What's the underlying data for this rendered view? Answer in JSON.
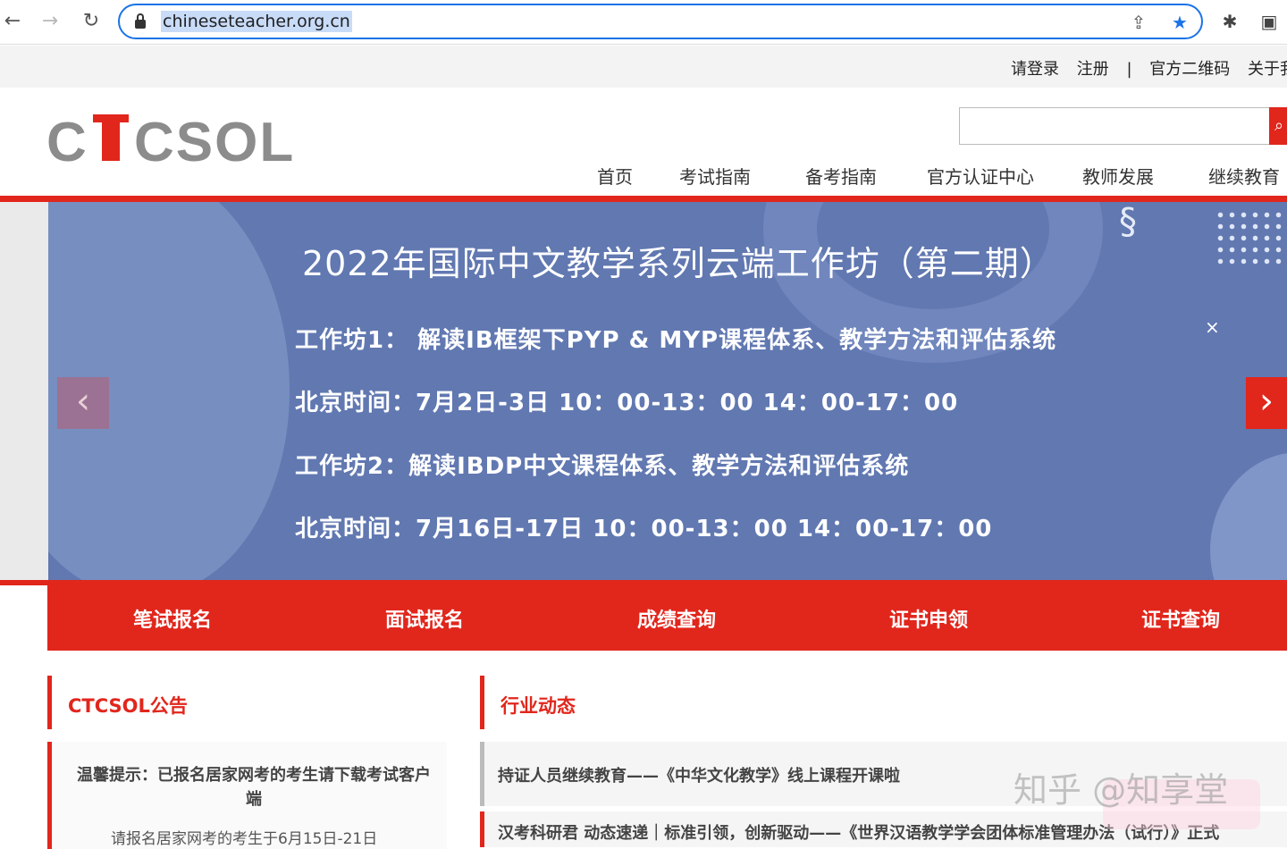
{
  "browser": {
    "url": "chineseteacher.org.cn",
    "back_icon": "←",
    "forward_icon": "→",
    "reload_icon": "↻",
    "share_icon": "⇪",
    "star_icon": "★",
    "extensions_icon": "✱",
    "window_icon": "▣"
  },
  "topbar": {
    "login": "请登录",
    "register": "注册",
    "separator": "|",
    "qrcode": "官方二维码",
    "about": "关于我"
  },
  "logo": {
    "text": "CTCSOL"
  },
  "search": {
    "placeholder": "",
    "button_icon": "⌕"
  },
  "nav": [
    {
      "label": "首页"
    },
    {
      "label": "考试指南"
    },
    {
      "label": "备考指南"
    },
    {
      "label": "官方认证中心"
    },
    {
      "label": "教师发展"
    },
    {
      "label": "继续教育"
    }
  ],
  "banner": {
    "title": "2022年国际中文教学系列云端工作坊（第二期）",
    "lines": [
      "工作坊1：  解读IB框架下PYP & MYP课程体系、教学方法和评估系统",
      "北京时间：7月2日-3日  10：00-13：00   14：00-17：00",
      "工作坊2：解读IBDP中文课程体系、教学方法和评估系统",
      "北京时间：7月16日-17日  10：00-13：00   14：00-17：00"
    ],
    "close_icon": "×",
    "prev_icon": "‹",
    "next_icon": "›"
  },
  "quick_links": [
    {
      "label": "笔试报名"
    },
    {
      "label": "面试报名"
    },
    {
      "label": "成绩查询"
    },
    {
      "label": "证书申领"
    },
    {
      "label": "证书查询"
    }
  ],
  "announcements": {
    "heading": "CTCSOL公告",
    "item_title": "温馨提示：已报名居家网考的考生请下载考试客户端",
    "item_sub": "请报名居家网考的考生于6月15日-21日"
  },
  "industry": {
    "heading": "行业动态",
    "items": [
      "持证人员继续教育——《中华文化教学》线上课程开课啦",
      "汉考科研君 动态速递｜标准引领，创新驱动——《世界汉语教学学会团体标准管理办法（试行）》正式"
    ]
  },
  "watermark": {
    "text": "知乎 @知享堂"
  },
  "colors": {
    "brand_red": "#e1261c",
    "banner_blue": "#6178b1",
    "omnibox_blue": "#1a73e8"
  }
}
